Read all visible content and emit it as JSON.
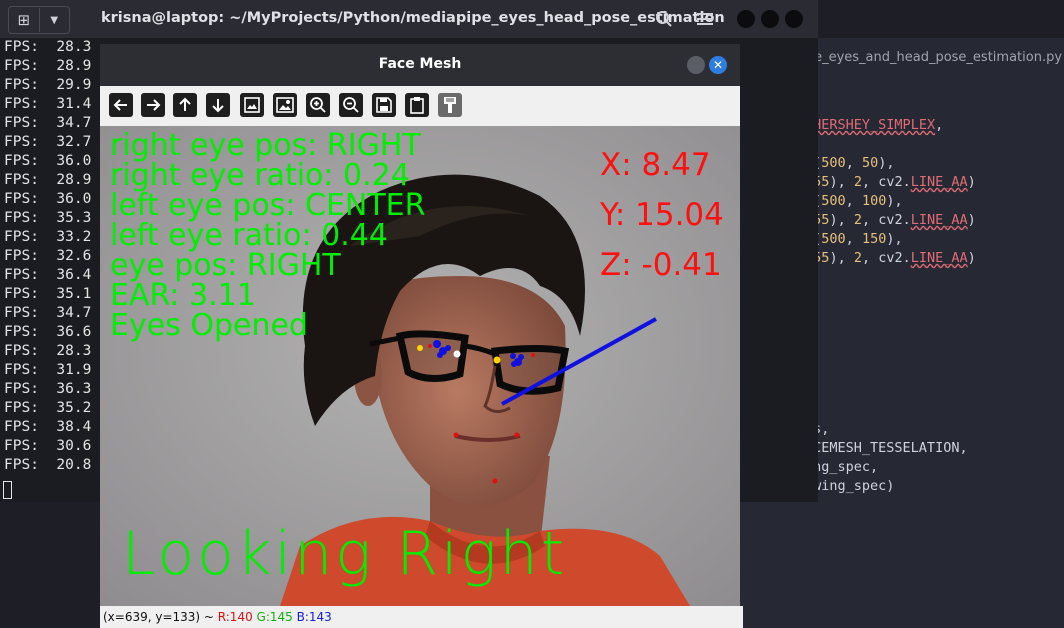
{
  "terminal": {
    "title": "krisna@laptop: ~/MyProjects/Python/mediapipe_eyes_head_pose_estimation",
    "icons": [
      "new-tab-icon",
      "dropdown-icon",
      "search-icon",
      "hamburger-icon"
    ],
    "fps_lines": [
      "FPS:  28.3",
      "FPS:  28.9",
      "FPS:  29.9",
      "FPS:  31.4",
      "FPS:  34.7",
      "FPS:  32.7",
      "FPS:  36.0",
      "FPS:  28.9",
      "FPS:  36.0",
      "FPS:  35.3",
      "FPS:  33.2",
      "FPS:  32.6",
      "FPS:  36.4",
      "FPS:  35.1",
      "FPS:  34.7",
      "FPS:  36.6",
      "FPS:  28.3",
      "FPS:  31.9",
      "FPS:  36.3",
      "FPS:  35.2",
      "FPS:  38.4",
      "FPS:  30.6",
      "FPS:  20.8"
    ]
  },
  "editor": {
    "tab_label": "apipe_eyes_and_head_pose_estimation.py"
  },
  "face_mesh": {
    "title": "Face Mesh",
    "toolbar_icons": [
      "arrow-left-icon",
      "arrow-right-icon",
      "arrow-up-icon",
      "arrow-down-icon",
      "image-icon",
      "image-properties-icon",
      "zoom-in-icon",
      "zoom-out-icon",
      "save-icon",
      "clipboard-icon",
      "properties-icon"
    ],
    "overlay": {
      "right_eye_pos": "right eye pos: RIGHT",
      "right_eye_ratio": "right eye ratio: 0.24",
      "left_eye_pos": "left eye pos: CENTER",
      "left_eye_ratio": "left eye ratio: 0.44",
      "eye_pos": "eye pos: RIGHT",
      "ear": "EAR: 3.11",
      "eyes_state": "Eyes Opened",
      "x": "X: 8.47",
      "y": "Y: 15.04",
      "z": "Z: -0.41",
      "direction": "Looking Right"
    },
    "status": {
      "coords": "(x=639, y=133) ~ ",
      "r": "R:140",
      "g": "G:145",
      "b": "B:143"
    }
  },
  "colors": {
    "overlay_green": "#00ee00",
    "overlay_red": "#ff1010",
    "pose_line": "#1010e0"
  }
}
